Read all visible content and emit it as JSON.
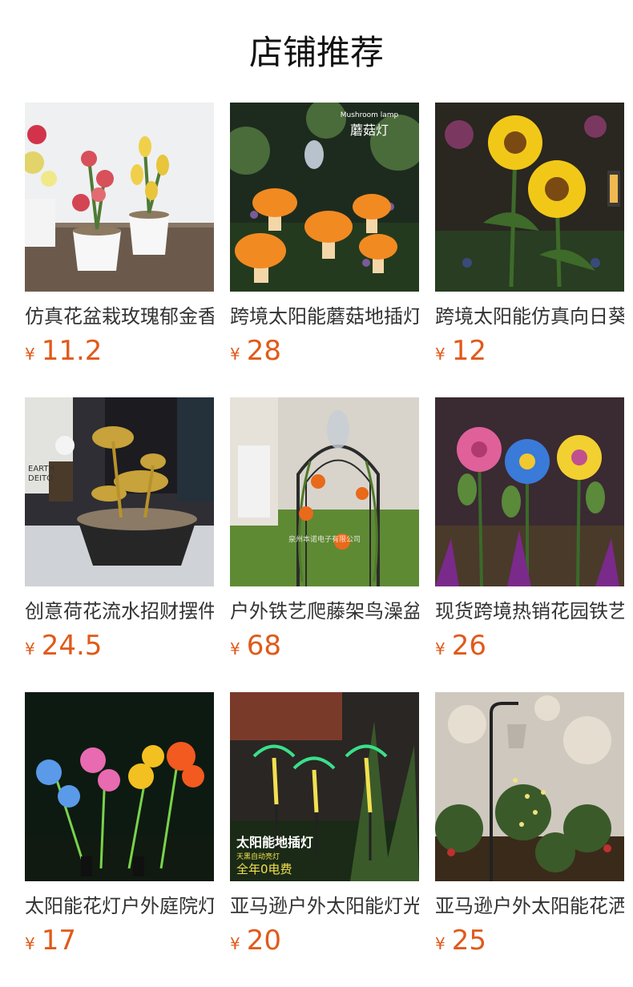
{
  "header": {
    "title": "店铺推荐"
  },
  "currency_symbol": "¥",
  "products": [
    {
      "name": "仿真花盆栽玫瑰郁金香",
      "price": "11.2"
    },
    {
      "name": "跨境太阳能蘑菇地插灯",
      "price": "28",
      "image_text": [
        "Mushroom lamp",
        "蘑菇灯"
      ]
    },
    {
      "name": "跨境太阳能仿真向日葵",
      "price": "12"
    },
    {
      "name": "创意荷花流水招财摆件",
      "price": "24.5",
      "image_text": [
        "EARTH",
        "DEITO"
      ]
    },
    {
      "name": "户外铁艺爬藤架鸟澡盆",
      "price": "68",
      "image_text": [
        "泉州本诺电子有限公司"
      ]
    },
    {
      "name": "现货跨境热销花园铁艺",
      "price": "26"
    },
    {
      "name": "太阳能花灯户外庭院灯",
      "price": "17"
    },
    {
      "name": "亚马逊户外太阳能灯光",
      "price": "20",
      "image_text": [
        "太阳能地插灯",
        "天黑自动亮灯",
        "全年0电费"
      ]
    },
    {
      "name": "亚马逊户外太阳能花洒",
      "price": "25"
    }
  ]
}
